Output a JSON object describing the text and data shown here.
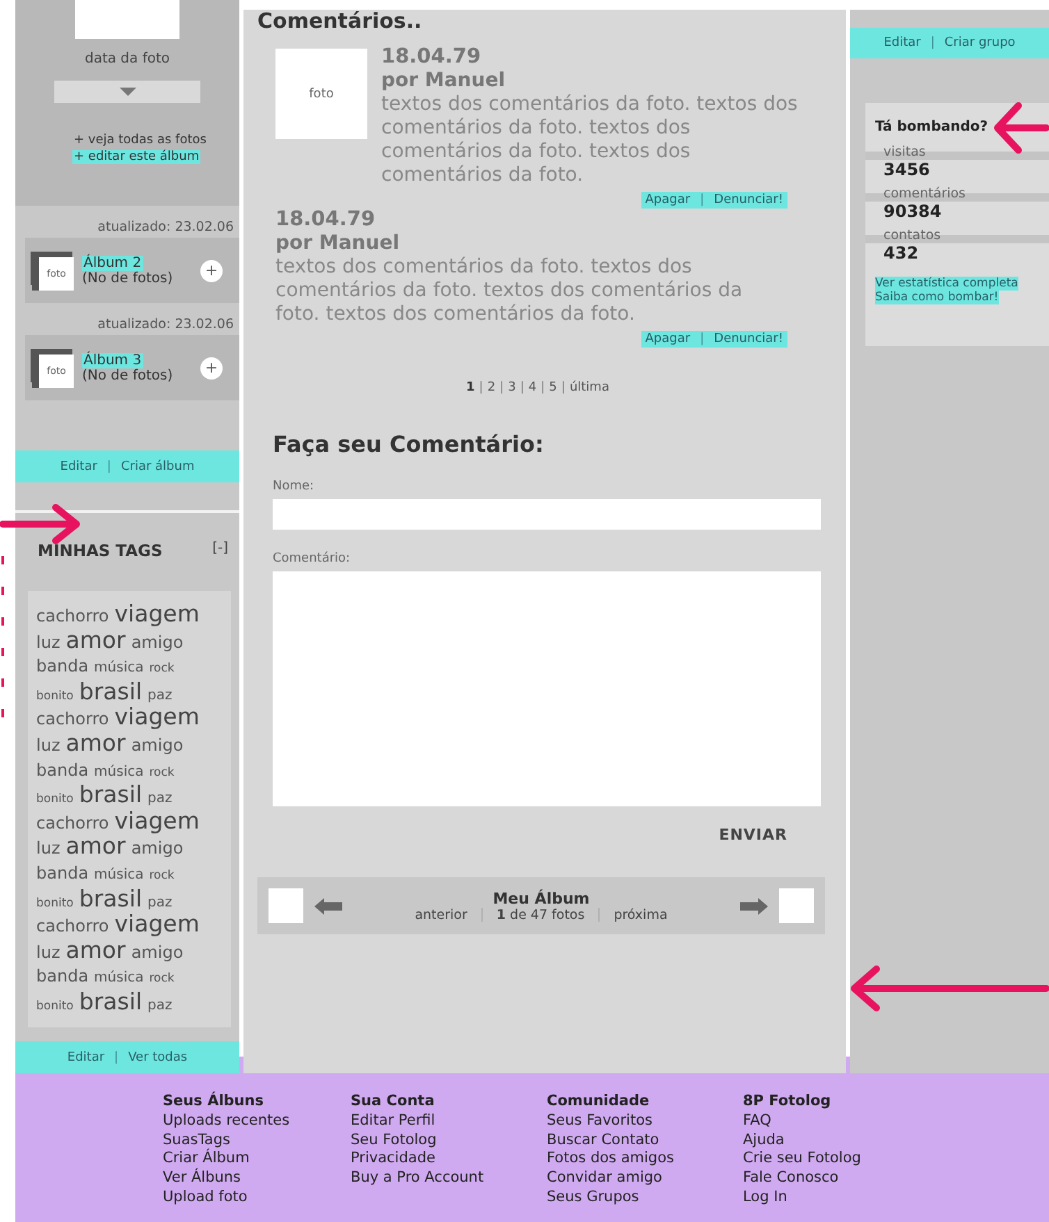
{
  "album_panel": {
    "date": "data da foto",
    "links": [
      {
        "text": "+ veja todas as fotos",
        "highlighted": false
      },
      {
        "text": "+ editar este álbum",
        "highlighted": true
      }
    ]
  },
  "albums": [
    {
      "updated": "atualizado: 23.02.06",
      "thumb": "foto",
      "name": "Álbum 2",
      "count": "(No de fotos)",
      "add": "+"
    },
    {
      "updated": "atualizado: 23.02.06",
      "thumb": "foto",
      "name": "Álbum 3",
      "count": "(No de fotos)",
      "add": "+"
    }
  ],
  "album_actions": [
    {
      "kind": "link",
      "text": "Editar"
    },
    {
      "kind": "separator",
      "text": "|"
    },
    {
      "kind": "link",
      "text": "Criar álbum"
    }
  ],
  "tags": {
    "title": "MINHAS TAGS",
    "toggle": "[-]",
    "rows": [
      [
        {
          "text": "cachorro",
          "kind": "medium"
        },
        {
          "text": "viagem",
          "kind": "huge"
        }
      ],
      [
        {
          "text": "luz",
          "kind": "medium"
        },
        {
          "text": "amor",
          "kind": "huge"
        },
        {
          "text": "amigo",
          "kind": "medium"
        }
      ],
      [
        {
          "text": "banda",
          "kind": "medium"
        },
        {
          "text": "música",
          "kind": "small"
        },
        {
          "text": "rock",
          "kind": "tiny"
        }
      ],
      [
        {
          "text": "bonito",
          "kind": "tiny"
        },
        {
          "text": "brasil",
          "kind": "huge"
        },
        {
          "text": "paz",
          "kind": "small"
        }
      ],
      [
        {
          "text": "cachorro",
          "kind": "medium"
        },
        {
          "text": "viagem",
          "kind": "huge"
        }
      ],
      [
        {
          "text": "luz",
          "kind": "medium"
        },
        {
          "text": "amor",
          "kind": "huge"
        },
        {
          "text": "amigo",
          "kind": "medium"
        }
      ],
      [
        {
          "text": "banda",
          "kind": "medium"
        },
        {
          "text": "música",
          "kind": "small"
        },
        {
          "text": "rock",
          "kind": "tiny"
        }
      ],
      [
        {
          "text": "bonito",
          "kind": "tiny"
        },
        {
          "text": "brasil",
          "kind": "huge"
        },
        {
          "text": "paz",
          "kind": "small"
        }
      ],
      [
        {
          "text": "cachorro",
          "kind": "medium"
        },
        {
          "text": "viagem",
          "kind": "huge"
        }
      ],
      [
        {
          "text": "luz",
          "kind": "medium"
        },
        {
          "text": "amor",
          "kind": "huge"
        },
        {
          "text": "amigo",
          "kind": "medium"
        }
      ],
      [
        {
          "text": "banda",
          "kind": "medium"
        },
        {
          "text": "música",
          "kind": "small"
        },
        {
          "text": "rock",
          "kind": "tiny"
        }
      ],
      [
        {
          "text": "bonito",
          "kind": "tiny"
        },
        {
          "text": "brasil",
          "kind": "huge"
        },
        {
          "text": "paz",
          "kind": "small"
        }
      ],
      [
        {
          "text": "cachorro",
          "kind": "medium"
        },
        {
          "text": "viagem",
          "kind": "huge"
        }
      ],
      [
        {
          "text": "luz",
          "kind": "medium"
        },
        {
          "text": "amor",
          "kind": "huge"
        },
        {
          "text": "amigo",
          "kind": "medium"
        }
      ],
      [
        {
          "text": "banda",
          "kind": "medium"
        },
        {
          "text": "música",
          "kind": "small"
        },
        {
          "text": "rock",
          "kind": "tiny"
        }
      ],
      [
        {
          "text": "bonito",
          "kind": "tiny"
        },
        {
          "text": "brasil",
          "kind": "huge"
        },
        {
          "text": "paz",
          "kind": "small"
        }
      ]
    ],
    "actions": [
      {
        "kind": "link",
        "text": "Editar"
      },
      {
        "kind": "separator",
        "text": "|"
      },
      {
        "kind": "link",
        "text": "Ver todas"
      }
    ]
  },
  "comments": {
    "title": "Comentários..",
    "items": [
      {
        "kind": "with_photo",
        "photo": "foto",
        "date": "18.04.79",
        "author": "por Manuel",
        "text": "textos dos comentários da foto. textos dos comentários da foto. textos dos comentários da foto. textos dos comentários da foto.",
        "actions": [
          {
            "kind": "link",
            "text": "Apagar"
          },
          {
            "kind": "separator",
            "text": "|"
          },
          {
            "kind": "link",
            "text": "Denunciar!"
          }
        ]
      },
      {
        "kind": "plain",
        "date": "18.04.79",
        "author": "por Manuel",
        "text": "textos dos comentários da foto. textos dos comentários da foto. textos dos comentários da foto. textos dos comentários da foto.",
        "actions": [
          {
            "kind": "link",
            "text": "Apagar"
          },
          {
            "kind": "separator",
            "text": "|"
          },
          {
            "kind": "link",
            "text": "Denunciar!"
          }
        ]
      }
    ]
  },
  "pagination": [
    {
      "kind": "page",
      "label": "1",
      "selected": true
    },
    {
      "kind": "separator",
      "label": "|"
    },
    {
      "kind": "page",
      "label": "2",
      "selected": false
    },
    {
      "kind": "separator",
      "label": "|"
    },
    {
      "kind": "page",
      "label": "3",
      "selected": false
    },
    {
      "kind": "separator",
      "label": "|"
    },
    {
      "kind": "page",
      "label": "4",
      "selected": false
    },
    {
      "kind": "separator",
      "label": "|"
    },
    {
      "kind": "page",
      "label": "5",
      "selected": false
    },
    {
      "kind": "separator",
      "label": "|"
    },
    {
      "kind": "page",
      "label": "última",
      "selected": false
    }
  ],
  "form": {
    "title": "Faça seu Comentário:",
    "name_label": "Nome:",
    "comment_label": "Comentário:",
    "submit": "ENVIAR"
  },
  "album_nav": {
    "title": "Meu Álbum",
    "prev": "anterior",
    "position": "**1** de 47 fotos",
    "next": "próxima"
  },
  "group_actions": [
    {
      "kind": "link",
      "text": "Editar"
    },
    {
      "kind": "separator",
      "text": "|"
    },
    {
      "kind": "link",
      "text": "Criar grupo"
    }
  ],
  "stats": {
    "title": "Tá bombando?",
    "items": [
      {
        "label": "visitas",
        "value": "3456"
      },
      {
        "label": "comentários",
        "value": "90384"
      },
      {
        "label": "contatos",
        "value": "432"
      }
    ],
    "links": [
      "Ver estatística completa",
      "Saiba como bombar!"
    ]
  },
  "footer": {
    "columns": [
      {
        "title": "Seus Álbuns",
        "links": [
          "Uploads recentes",
          "SuasTags",
          "Criar Álbum",
          "Ver Álbuns",
          "Upload foto"
        ]
      },
      {
        "title": "Sua Conta",
        "links": [
          "Editar Perfil",
          "Seu Fotolog",
          "Privacidade",
          "Buy a Pro Account"
        ]
      },
      {
        "title": "Comunidade",
        "links": [
          "Seus Favoritos",
          "Buscar Contato",
          "Fotos dos amigos",
          "Convidar amigo",
          "Seus Grupos"
        ]
      },
      {
        "title": "8P Fotolog",
        "links": [
          "FAQ",
          "Ajuda",
          "Crie seu Fotolog",
          "Fale Conosco",
          "Log In"
        ]
      }
    ]
  }
}
